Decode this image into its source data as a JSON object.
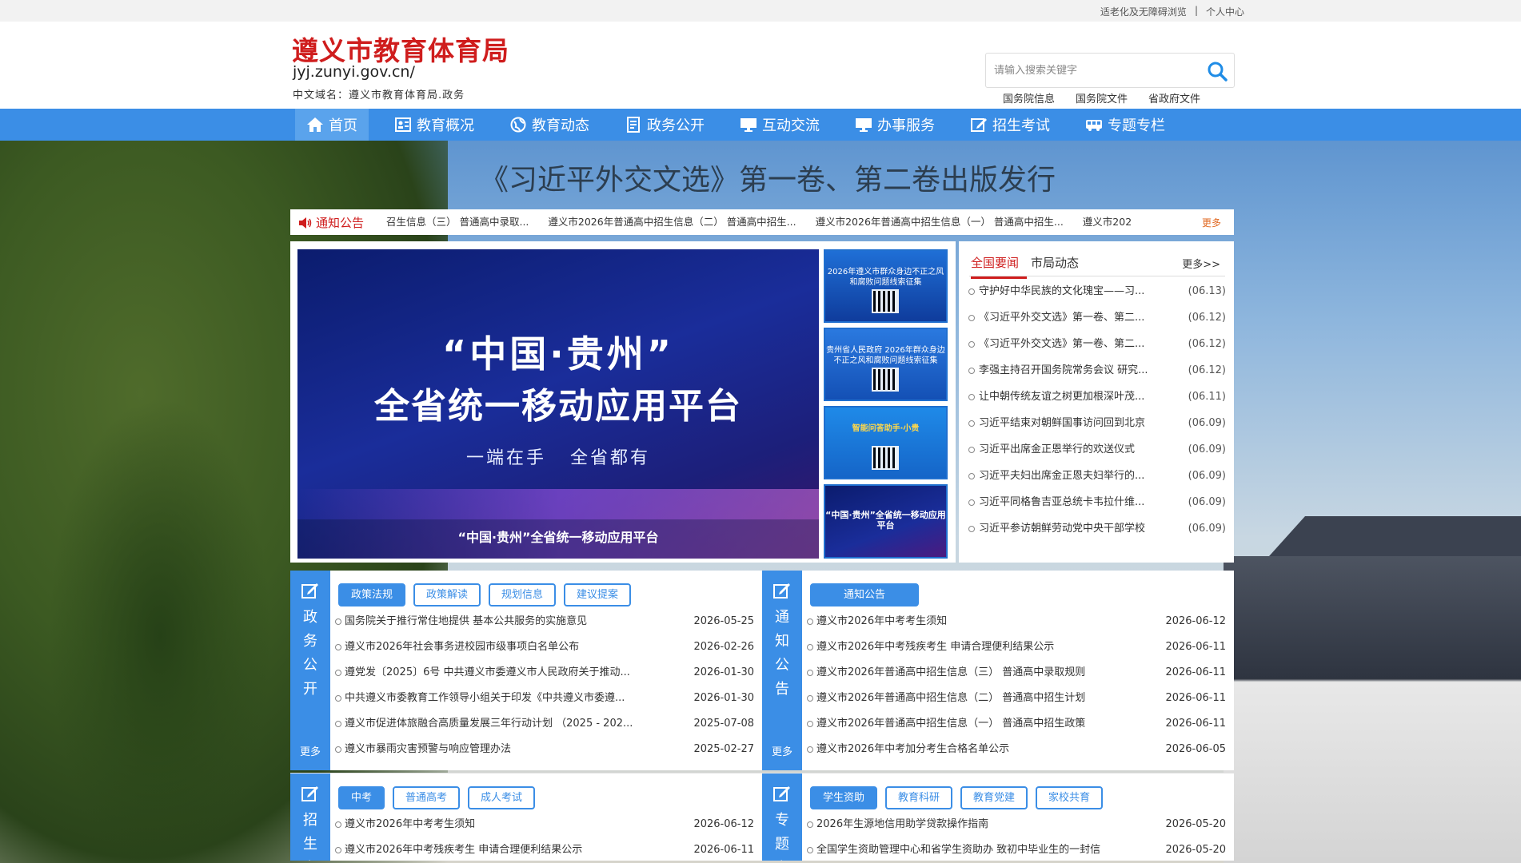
{
  "topbar": {
    "accessibility": "适老化及无障碍浏览",
    "separator": "|",
    "personal": "个人中心"
  },
  "header": {
    "title": "遵义市教育体育局",
    "domain": "jyj.zunyi.gov.cn/",
    "cn_domain": "中文域名：遵义市教育体育局.政务"
  },
  "search": {
    "placeholder": "请输入搜索关键字",
    "icon": "search-icon"
  },
  "quick_links": [
    "国务院信息",
    "国务院文件",
    "省政府文件"
  ],
  "nav": [
    {
      "label": "首页",
      "icon": "home-icon"
    },
    {
      "label": "教育概况",
      "icon": "profile-icon"
    },
    {
      "label": "教育动态",
      "icon": "globe-icon"
    },
    {
      "label": "政务公开",
      "icon": "document-icon"
    },
    {
      "label": "互动交流",
      "icon": "monitor-icon"
    },
    {
      "label": "办事服务",
      "icon": "monitor-icon"
    },
    {
      "label": "招生考试",
      "icon": "edit-icon"
    },
    {
      "label": "专题专栏",
      "icon": "bus-icon"
    }
  ],
  "headline": "《习近平外交文选》第一卷、第二卷出版发行",
  "notice_bar": {
    "label": "通知公告",
    "items": [
      "召生信息（三） 普通高中录取...",
      "遵义市2026年普通高中招生信息（二） 普通高中招生...",
      "遵义市2026年普通高中招生信息（一） 普通高中招生...",
      "遵义市202"
    ],
    "more": "更多"
  },
  "slider": {
    "line1": "“中国·贵州”",
    "line2": "全省统一移动应用平台",
    "line3": "一端在手   全省都有",
    "caption": "“中国·贵州”全省统一移动应用平台",
    "thumbs": [
      "2026年遵义市群众身边不正之风和腐败问题线索征集",
      "贵州省人民政府 2026年群众身边不正之风和腐败问题线索征集",
      "智能问答助手·小贵",
      "“中国·贵州”全省统一移动应用平台"
    ]
  },
  "news": {
    "tabs": [
      "全国要闻",
      "市局动态"
    ],
    "more": "更多>>",
    "items": [
      {
        "title": "守护好中华民族的文化瑰宝——习...",
        "date": "(06.13)"
      },
      {
        "title": "《习近平外交文选》第一卷、第二...",
        "date": "(06.12)"
      },
      {
        "title": "《习近平外交文选》第一卷、第二...",
        "date": "(06.12)"
      },
      {
        "title": "李强主持召开国务院常务会议 研究...",
        "date": "(06.12)"
      },
      {
        "title": "让中朝传统友谊之树更加根深叶茂...",
        "date": "(06.11)"
      },
      {
        "title": "习近平结束对朝鲜国事访问回到北京",
        "date": "(06.09)"
      },
      {
        "title": "习近平出席金正恩举行的欢送仪式",
        "date": "(06.09)"
      },
      {
        "title": "习近平夫妇出席金正恩夫妇举行的...",
        "date": "(06.09)"
      },
      {
        "title": "习近平同格鲁吉亚总统卡韦拉什维...",
        "date": "(06.09)"
      },
      {
        "title": "习近平参访朝鲜劳动党中央干部学校",
        "date": "(06.09)"
      }
    ]
  },
  "panel_gov": {
    "side": "政务公开",
    "more": "更多",
    "tabs": [
      "政策法规",
      "政策解读",
      "规划信息",
      "建议提案"
    ],
    "items": [
      {
        "title": "国务院关于推行常住地提供 基本公共服务的实施意见",
        "date": "2026-05-25"
      },
      {
        "title": "遵义市2026年社会事务进校园市级事项白名单公布",
        "date": "2026-02-26"
      },
      {
        "title": "遵党发〔2025〕6号 中共遵义市委遵义市人民政府关于推动...",
        "date": "2026-01-30"
      },
      {
        "title": "中共遵义市委教育工作领导小组关于印发《中共遵义市委遵...",
        "date": "2026-01-30"
      },
      {
        "title": "遵义市促进体旅融合高质量发展三年行动计划 （2025 - 202...",
        "date": "2025-07-08"
      },
      {
        "title": "遵义市暴雨灾害预警与响应管理办法",
        "date": "2025-02-27"
      }
    ]
  },
  "panel_notice": {
    "side": "通知公告",
    "more": "更多",
    "tabs": [
      "通知公告"
    ],
    "items": [
      {
        "title": "遵义市2026年中考考生须知",
        "date": "2026-06-12"
      },
      {
        "title": "遵义市2026年中考残疾考生 申请合理便利结果公示",
        "date": "2026-06-11"
      },
      {
        "title": "遵义市2026年普通高中招生信息（三） 普通高中录取规则",
        "date": "2026-06-11"
      },
      {
        "title": "遵义市2026年普通高中招生信息（二） 普通高中招生计划",
        "date": "2026-06-11"
      },
      {
        "title": "遵义市2026年普通高中招生信息（一） 普通高中招生政策",
        "date": "2026-06-11"
      },
      {
        "title": "遵义市2026年中考加分考生合格名单公示",
        "date": "2026-06-05"
      }
    ]
  },
  "panel_exam": {
    "side": "招生考",
    "tabs": [
      "中考",
      "普通高考",
      "成人考试"
    ],
    "items": [
      {
        "title": "遵义市2026年中考考生须知",
        "date": "2026-06-12"
      },
      {
        "title": "遵义市2026年中考残疾考生 申请合理便利结果公示",
        "date": "2026-06-11"
      }
    ]
  },
  "panel_topic": {
    "side": "专题专",
    "tabs": [
      "学生资助",
      "教育科研",
      "教育党建",
      "家校共育"
    ],
    "items": [
      {
        "title": "2026年生源地信用助学贷款操作指南",
        "date": "2026-05-20"
      },
      {
        "title": "全国学生资助管理中心和省学生资助办 致初中毕业生的一封信",
        "date": "2026-05-20"
      }
    ]
  },
  "colors": {
    "brand_red": "#cf1d1d",
    "nav_blue": "#3b8ee6",
    "more_orange": "#e0671f"
  }
}
